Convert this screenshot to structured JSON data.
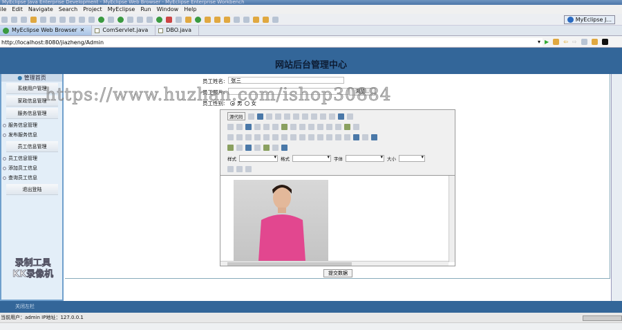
{
  "window": {
    "title": "MyEclipse Java Enterprise Development - MyEclipse Web Browser - MyEclipse Enterprise Workbench"
  },
  "menu": [
    "ile",
    "Edit",
    "Navigate",
    "Search",
    "Project",
    "MyEclipse",
    "Run",
    "Window",
    "Help"
  ],
  "perspective": "MyEclipse J...",
  "tabs": [
    {
      "label": "MyEclipse Web Browser"
    },
    {
      "label": "ComServlet.java"
    },
    {
      "label": "DBO.java"
    }
  ],
  "address": "http://localhost:8080/jiazheng/Admin",
  "page": {
    "title": "网站后台管理中心",
    "sidebar": {
      "top": "管理首页",
      "items": [
        {
          "label": "系统用户管理",
          "type": "section"
        },
        {
          "label": "家政信息管理",
          "type": "section"
        },
        {
          "label": "服务信息管理",
          "type": "section"
        },
        {
          "label": "服务信息管理",
          "type": "sub"
        },
        {
          "label": "发布服务信息",
          "type": "sub"
        },
        {
          "label": "员工信息管理",
          "type": "section"
        },
        {
          "label": "员工信息管理",
          "type": "sub"
        },
        {
          "label": "添加员工信息",
          "type": "sub"
        },
        {
          "label": "查询员工信息",
          "type": "sub"
        },
        {
          "label": "退出登陆",
          "type": "section"
        }
      ]
    },
    "form": {
      "name_label": "员工姓名:",
      "name_value": "张三",
      "photo_label": "员工照片:",
      "browse": "浏览...",
      "gender_label": "员工性别:",
      "male": "男",
      "female": "女",
      "gender_selected": "男"
    },
    "editor": {
      "source": "源代码",
      "style_label": "样式",
      "format_label": "格式",
      "font_label": "字体",
      "size_label": "大小"
    },
    "submit": "提交数据"
  },
  "footer": {
    "close": "关闭左栏",
    "status": "当前用户：admin  IP地址：127.0.0.1"
  },
  "watermark": "https://www.huzhan.com/ishop30884",
  "logo_watermark": "录制工具 KK录像机"
}
